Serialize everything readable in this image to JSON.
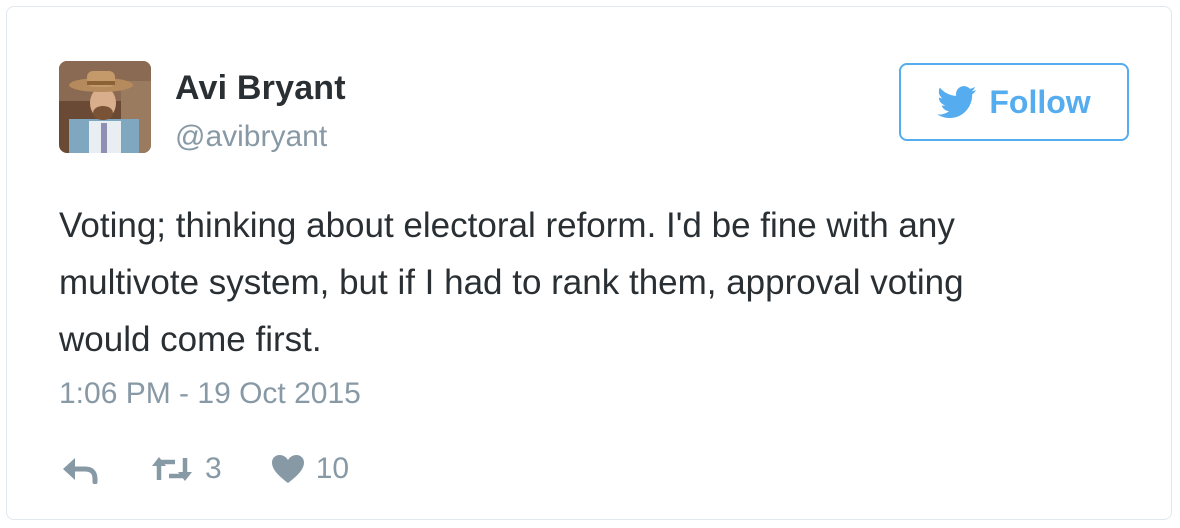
{
  "author": {
    "name": "Avi Bryant",
    "handle": "@avibryant",
    "avatar_icon": "user-avatar-photo"
  },
  "follow": {
    "label": "Follow",
    "icon": "twitter-bird-icon",
    "color": "#55acee"
  },
  "tweet": {
    "lines": [
      "Voting; thinking about electoral reform. I'd be fine with any",
      "multivote system, but if I had to rank them, approval voting",
      "would come first."
    ],
    "timestamp": "1:06 PM - 19 Oct 2015"
  },
  "actions": {
    "reply_icon": "reply-icon",
    "retweet_icon": "retweet-icon",
    "retweet_count": "3",
    "like_icon": "heart-icon",
    "like_count": "10"
  },
  "colors": {
    "text": "#292f33",
    "muted": "#8899a6",
    "border": "#e1e8ed"
  }
}
